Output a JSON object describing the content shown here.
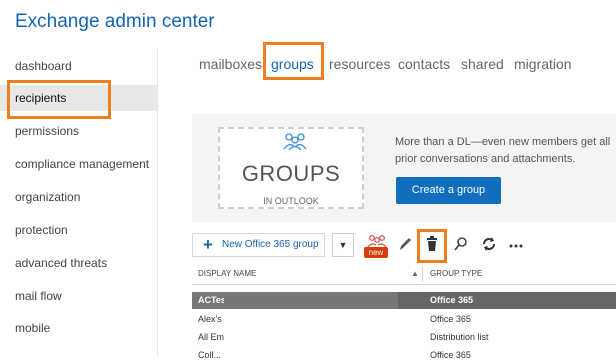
{
  "app": {
    "title": "Exchange admin center"
  },
  "sidebar": {
    "items": [
      {
        "label": "dashboard"
      },
      {
        "label": "recipients"
      },
      {
        "label": "permissions"
      },
      {
        "label": "compliance management"
      },
      {
        "label": "organization"
      },
      {
        "label": "protection"
      },
      {
        "label": "advanced threats"
      },
      {
        "label": "mail flow"
      },
      {
        "label": "mobile"
      }
    ],
    "active": "recipients"
  },
  "tabs": [
    {
      "label": "mailboxes"
    },
    {
      "label": "groups"
    },
    {
      "label": "resources"
    },
    {
      "label": "contacts"
    },
    {
      "label": "shared"
    },
    {
      "label": "migration"
    }
  ],
  "promo": {
    "art_title": "GROUPS",
    "art_subtitle": "IN OUTLOOK",
    "text": "More than a DL—even new members get all prior conversations and attachments.",
    "cta_label": "Create a group"
  },
  "toolbar": {
    "new_group_label": "New Office 365 group",
    "new_badge": "new",
    "icons": [
      "plus-icon",
      "chevron-down-icon",
      "people-new-icon",
      "pencil-icon",
      "trash-icon",
      "search-icon",
      "refresh-icon",
      "more-icon"
    ]
  },
  "table": {
    "columns": [
      "DISPLAY NAME",
      "GROUP TYPE"
    ],
    "sort_indicator": "▲",
    "rows": [
      {
        "name": "ACTes",
        "type": "Office 365",
        "selected": true
      },
      {
        "name": "Alex's",
        "type": "Office 365"
      },
      {
        "name": "All Em",
        "type": "Distribution list"
      },
      {
        "name": "Coll...",
        "type": "Office 365"
      }
    ]
  },
  "colors": {
    "accent": "#1565b0",
    "highlight": "#f07d1e",
    "cta": "#106ebe",
    "badge": "#d83b01"
  }
}
